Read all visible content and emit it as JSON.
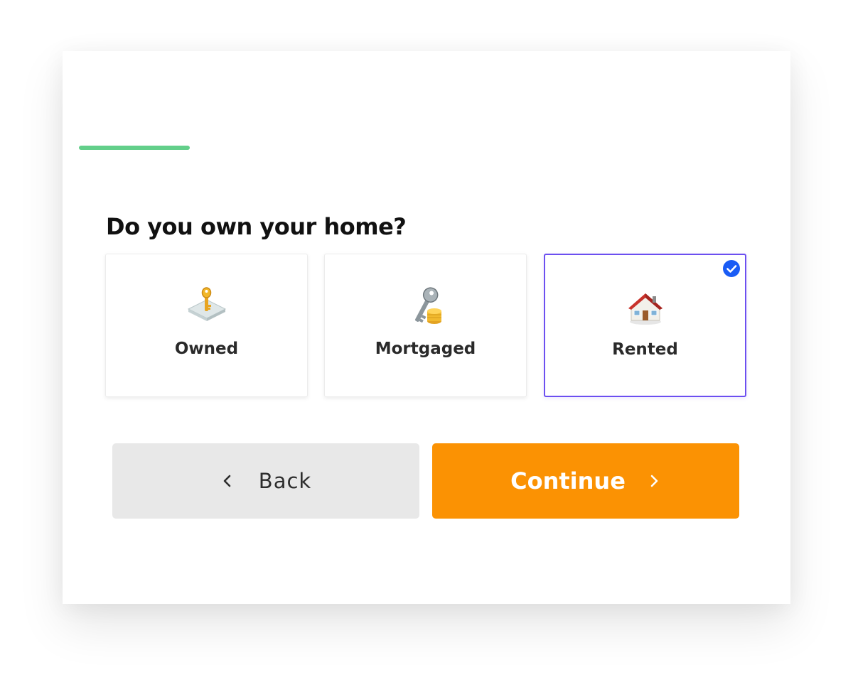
{
  "form": {
    "question": "Do you own your home?",
    "options": [
      {
        "label": "Owned",
        "icon": "key-icon",
        "selected": false
      },
      {
        "label": "Mortgaged",
        "icon": "key-coins-icon",
        "selected": false
      },
      {
        "label": "Rented",
        "icon": "house-icon",
        "selected": true
      }
    ],
    "progress": 0.15,
    "accent_color": "#63cf8a",
    "selected_color": "#6c4ff0",
    "check_color": "#1a5cf5"
  },
  "actions": {
    "back_label": "Back",
    "continue_label": "Continue",
    "back_color": "#e8e8e8",
    "continue_color": "#fb9203"
  }
}
